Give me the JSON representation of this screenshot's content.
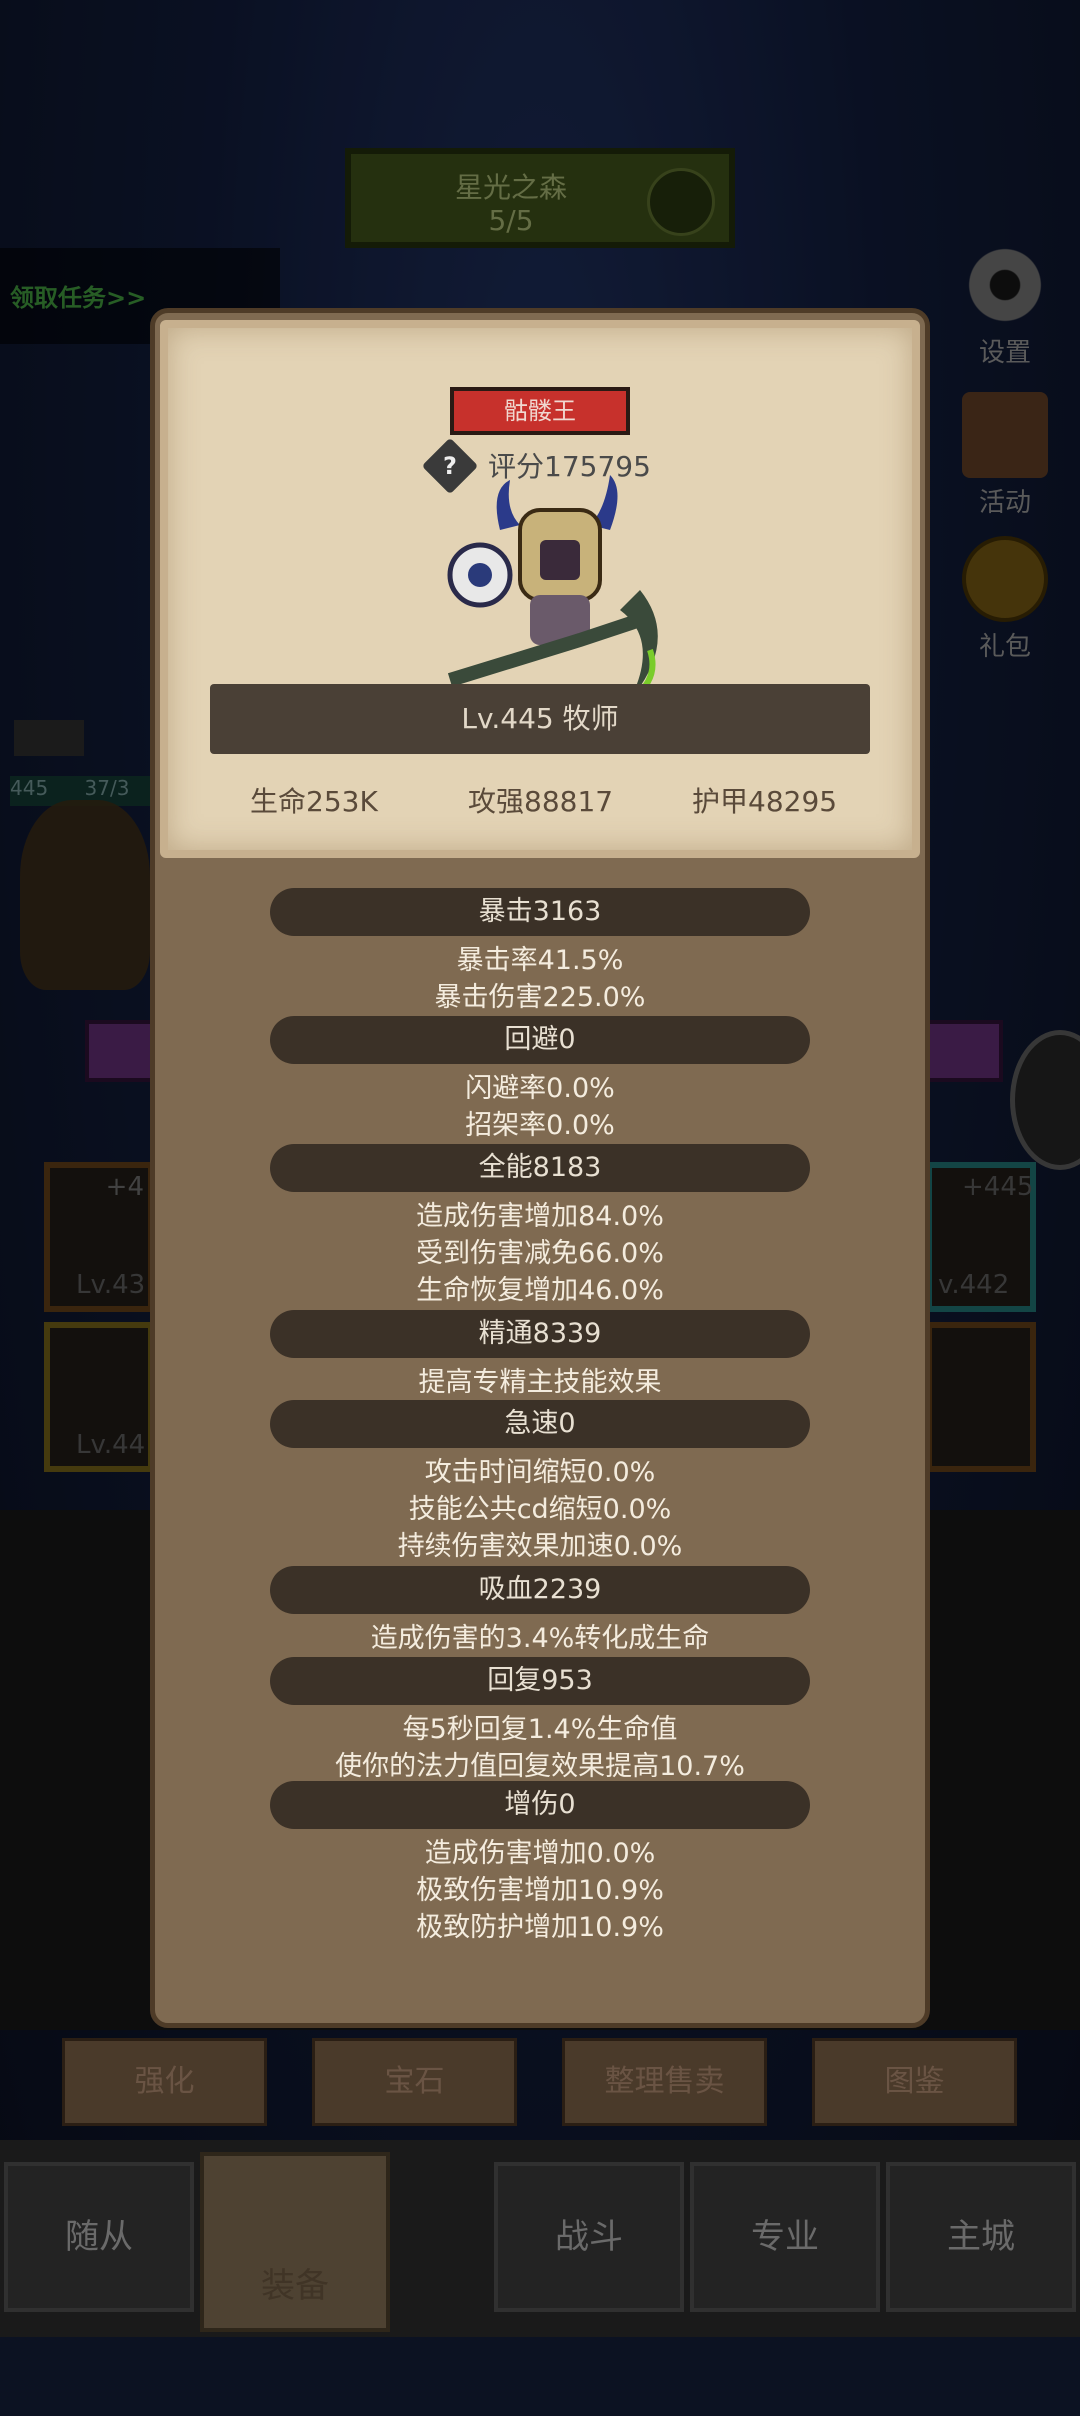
{
  "stage": {
    "name": "星光之森",
    "progress": "5/5"
  },
  "quest_label": "领取任务>>",
  "right_menu": {
    "settings": "设置",
    "activity": "活动",
    "gift": "礼包"
  },
  "enemy": {
    "level": "445",
    "hp": "37/3"
  },
  "slots": {
    "s1_top": "+4",
    "s1_lv": "Lv.43",
    "s2_lv": "Lv.44",
    "s3_top": "+445",
    "s3_lv": "v.442"
  },
  "popup": {
    "title": "骷髅王",
    "score": "评分175795",
    "level_class": "Lv.445 牧师",
    "stats": {
      "hp": "生命253K",
      "atk": "攻强88817",
      "armor": "护甲48295"
    },
    "sections": [
      {
        "header": "暴击3163",
        "lines": [
          "暴击率41.5%",
          "暴击伤害225.0%"
        ]
      },
      {
        "header": "回避0",
        "lines": [
          "闪避率0.0%",
          "招架率0.0%"
        ]
      },
      {
        "header": "全能8183",
        "lines": [
          "造成伤害增加84.0%",
          "受到伤害减免66.0%",
          "生命恢复增加46.0%"
        ]
      },
      {
        "header": "精通8339",
        "lines": [
          "提高专精主技能效果"
        ]
      },
      {
        "header": "急速0",
        "lines": [
          "攻击时间缩短0.0%",
          "技能公共cd缩短0.0%",
          "持续伤害效果加速0.0%"
        ]
      },
      {
        "header": "吸血2239",
        "lines": [
          "造成伤害的3.4%转化成生命"
        ]
      },
      {
        "header": "回复953",
        "lines": [
          "每5秒回复1.4%生命值",
          "使你的法力值回复效果提高10.7%"
        ]
      },
      {
        "header": "增伤0",
        "lines": [
          "造成伤害增加0.0%",
          "极致伤害增加10.9%",
          "极致防护增加10.9%"
        ]
      }
    ]
  },
  "bottom_buttons": [
    "强化",
    "宝石",
    "整理售卖",
    "图鉴"
  ],
  "tabs": [
    "随从",
    "装备",
    "战斗",
    "专业",
    "主城"
  ],
  "colors": {
    "title_red": "#c7312c",
    "panel": "#7f6a51",
    "card": "#e3d3b5",
    "ribbon": "#3b3127"
  }
}
